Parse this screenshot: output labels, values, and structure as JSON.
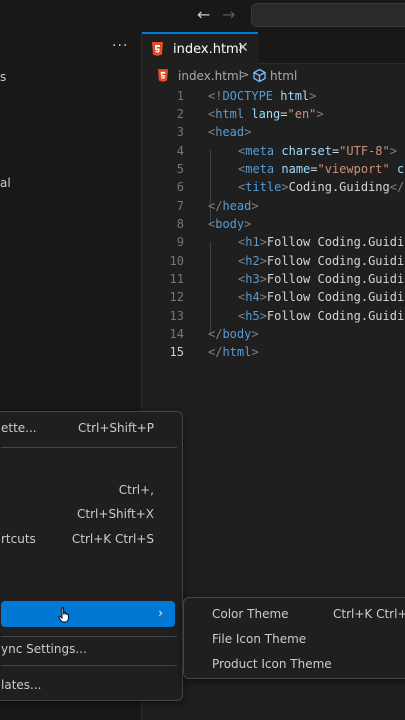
{
  "titlebar": {
    "back_icon": "arrow-left-icon",
    "forward_icon": "arrow-right-icon"
  },
  "sidebar": {
    "more_label": "···",
    "fragments": [
      "s",
      "al"
    ]
  },
  "tab": {
    "label": "index.html",
    "close": "✕"
  },
  "breadcrumb": {
    "file": "index.html",
    "separator": ">",
    "symbol": "html"
  },
  "editor": {
    "active_line": 15,
    "lines": [
      {
        "n": "1"
      },
      {
        "n": "2"
      },
      {
        "n": "3"
      },
      {
        "n": "4"
      },
      {
        "n": "5"
      },
      {
        "n": "6"
      },
      {
        "n": "7"
      },
      {
        "n": "8"
      },
      {
        "n": "9"
      },
      {
        "n": "10"
      },
      {
        "n": "11"
      },
      {
        "n": "12"
      },
      {
        "n": "13"
      },
      {
        "n": "14"
      },
      {
        "n": "15"
      }
    ],
    "code": {
      "l1": {
        "a": "<!",
        "b": "DOCTYPE",
        "c": " html",
        "d": ">"
      },
      "l2": {
        "a": "<",
        "b": "html",
        "c": " lang",
        "d": "=",
        "e": "\"en\"",
        "f": ">"
      },
      "l3": {
        "a": "<",
        "b": "head",
        "c": ">"
      },
      "l4": {
        "a": "<",
        "b": "meta",
        "c": " charset",
        "d": "=",
        "e": "\"UTF-8\"",
        "f": ">"
      },
      "l5": {
        "a": "<",
        "b": "meta",
        "c": " name",
        "d": "=",
        "e": "\"viewport\"",
        "f": " c"
      },
      "l6": {
        "a": "<",
        "b": "title",
        "c": ">",
        "d": "Coding.Guiding",
        "e": "</"
      },
      "l7": {
        "a": "</",
        "b": "head",
        "c": ">"
      },
      "l8": {
        "a": "<",
        "b": "body",
        "c": ">"
      },
      "l9": {
        "a": "<",
        "b": "h1",
        "c": ">",
        "d": "Follow Coding.Guidi"
      },
      "l10": {
        "a": "<",
        "b": "h2",
        "c": ">",
        "d": "Follow Coding.Guidi"
      },
      "l11": {
        "a": "<",
        "b": "h3",
        "c": ">",
        "d": "Follow Coding.Guidi"
      },
      "l12": {
        "a": "<",
        "b": "h4",
        "c": ">",
        "d": "Follow Coding.Guidi"
      },
      "l13": {
        "a": "<",
        "b": "h5",
        "c": ">",
        "d": "Follow Coding.Guidi"
      },
      "l14": {
        "a": "</",
        "b": "body",
        "c": ">"
      },
      "l15": {
        "a": "</",
        "b": "html",
        "c": ">"
      }
    }
  },
  "menu": {
    "items": [
      {
        "label": "ette...",
        "key": "Ctrl+Shift+P"
      },
      {
        "label": "",
        "key": "Ctrl+,"
      },
      {
        "label": "",
        "key": "Ctrl+Shift+X"
      },
      {
        "label": "rtcuts",
        "key": "Ctrl+K Ctrl+S"
      },
      {
        "label": "ync Settings...",
        "key": ""
      },
      {
        "label": "lates...",
        "key": ""
      }
    ],
    "submenu_arrow": "›"
  },
  "submenu": {
    "items": [
      {
        "label": "Color Theme",
        "key": "Ctrl+K Ctrl+T"
      },
      {
        "label": "File Icon Theme",
        "key": ""
      },
      {
        "label": "Product Icon Theme",
        "key": ""
      }
    ]
  },
  "colors": {
    "accent": "#0078d4",
    "background": "#1f1f1f",
    "sidebar": "#181818"
  }
}
